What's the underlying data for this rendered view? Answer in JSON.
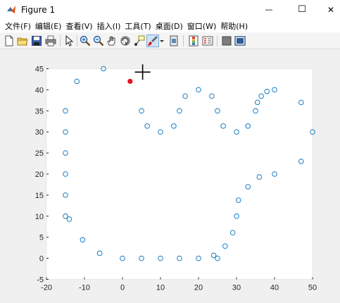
{
  "window": {
    "title": "Figure 1",
    "minimize_glyph": "—",
    "maximize_glyph": "☐",
    "close_glyph": "✕"
  },
  "menu": {
    "items": [
      "文件(F)",
      "编辑(E)",
      "查看(V)",
      "插入(I)",
      "工具(T)",
      "桌面(D)",
      "窗口(W)",
      "帮助(H)"
    ]
  },
  "toolbar": {
    "icons": [
      "new-figure-icon",
      "open-file-icon",
      "save-icon",
      "print-icon",
      "pointer-icon",
      "zoom-in-icon",
      "zoom-out-icon",
      "pan-hand-icon",
      "rotate-3d-icon",
      "data-cursor-icon",
      "brush-icon",
      "dropdown-arrow-icon",
      "link-plot-icon",
      "insert-colorbar-icon",
      "insert-legend-icon",
      "hide-plot-tools-icon",
      "show-plot-tools-icon"
    ]
  },
  "colors": {
    "marker": "#0072bd",
    "highlight_point": "#e8101e",
    "axes_bg": "#ffffff",
    "figure_bg": "#f0f0f0"
  },
  "chart_data": {
    "type": "scatter",
    "title": "",
    "xlabel": "",
    "ylabel": "",
    "xlim": [
      -20,
      50
    ],
    "ylim": [
      -5,
      45
    ],
    "xticks": [
      "-20",
      "-10",
      "0",
      "10",
      "20",
      "30",
      "40",
      "50"
    ],
    "yticks": [
      "-5",
      "0",
      "5",
      "10",
      "15",
      "20",
      "25",
      "30",
      "35",
      "40",
      "45"
    ],
    "grid": false,
    "legend": "none",
    "series": [
      {
        "marker": "open-circle",
        "x": [
          -12,
          -5,
          -15,
          -15,
          -15,
          -15,
          -15,
          -15,
          -14,
          -10.5,
          -6,
          0,
          5,
          10,
          15,
          20,
          24,
          25,
          27,
          29,
          30,
          30.5,
          33,
          36,
          40,
          47,
          50,
          5,
          6.5,
          10,
          13.5,
          15,
          16.5,
          20,
          23.5,
          25,
          26.5,
          30,
          33,
          35,
          35.5,
          36.5,
          38,
          40,
          47
        ],
        "y": [
          42,
          45,
          35,
          30,
          25,
          20,
          15,
          10,
          9.3,
          4.4,
          1.2,
          0,
          0,
          0,
          0,
          0,
          0.7,
          0,
          2.9,
          6.1,
          10,
          13.8,
          17,
          19.3,
          20,
          23,
          30,
          35,
          31.4,
          30,
          31.4,
          35,
          38.5,
          40,
          38.5,
          35,
          31.4,
          30,
          31.4,
          35,
          37,
          38.5,
          39.6,
          40,
          37
        ]
      }
    ],
    "highlight_point": {
      "x": 2,
      "y": 42
    },
    "crosshair_cursor": {
      "x": 5.3,
      "y": 44.2
    }
  }
}
